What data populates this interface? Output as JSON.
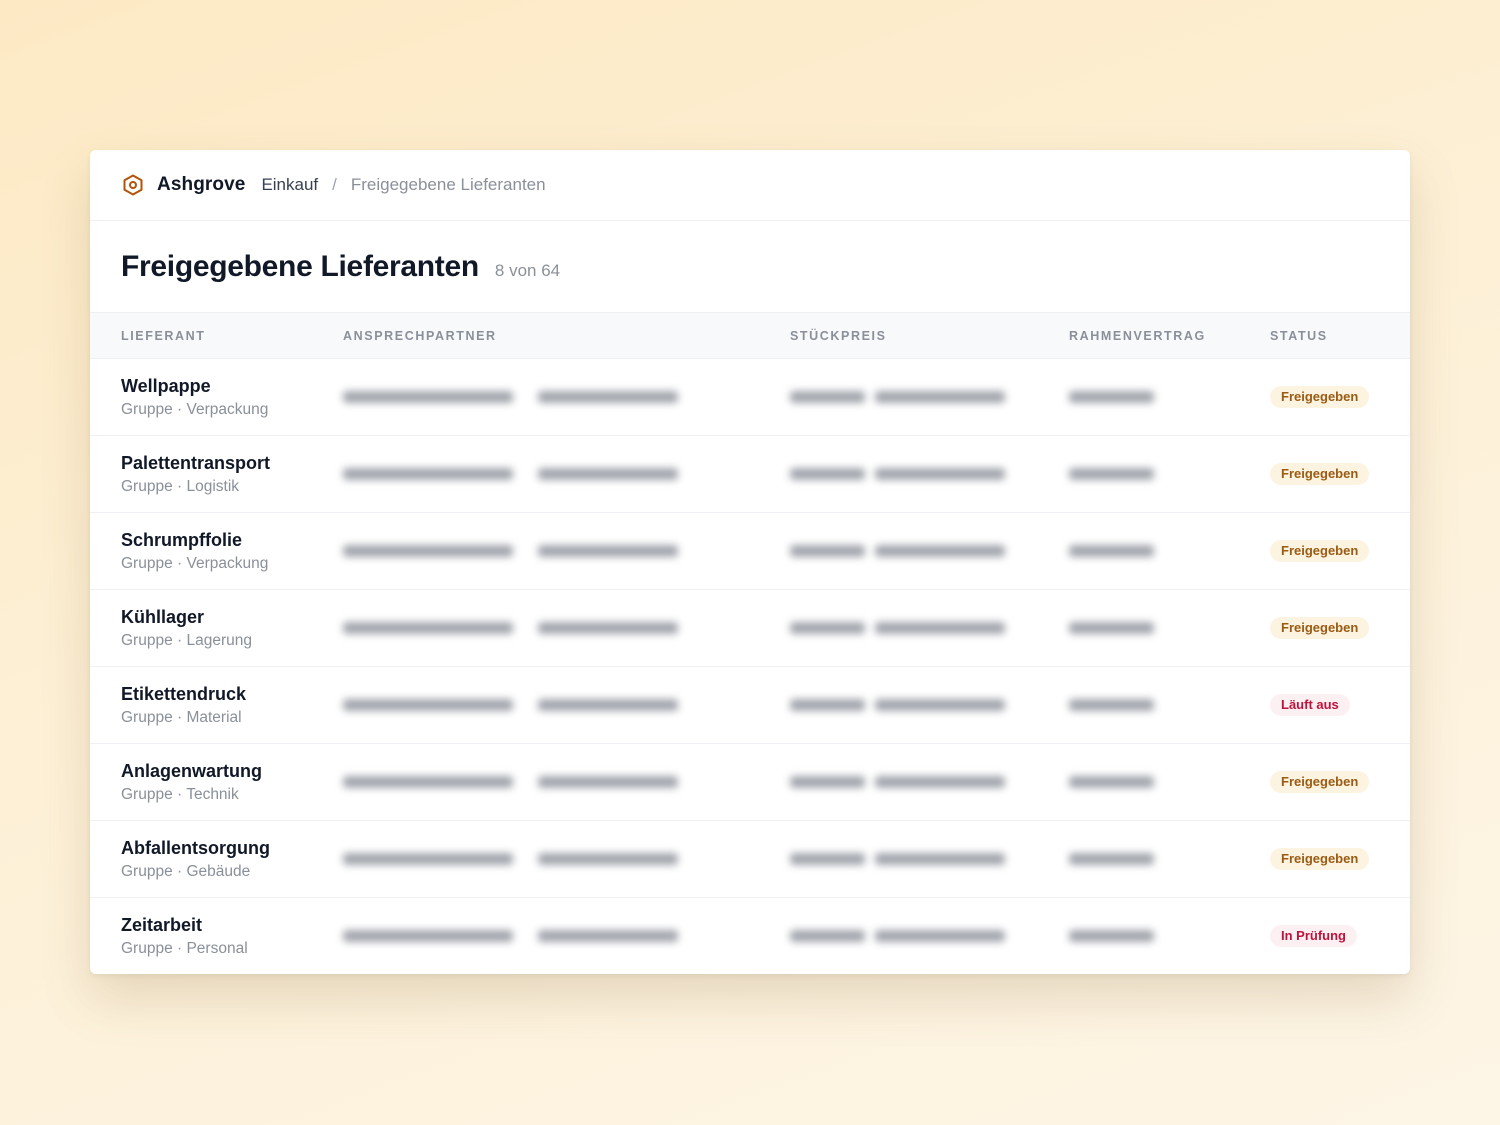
{
  "colors": {
    "accent": "#b45309",
    "badge_approved_bg": "#fdf3e1",
    "badge_approved_text": "#9a5b12",
    "badge_warning_bg": "#fdf0f2",
    "badge_warning_text": "#be123c"
  },
  "header": {
    "logo_icon": "hexagon-icon",
    "brand": "Ashgrove",
    "breadcrumb": {
      "parent": "Einkauf",
      "separator": "/",
      "current": "Freigegebene Lieferanten"
    }
  },
  "page": {
    "title": "Freigegebene Lieferanten",
    "count": "8 von 64"
  },
  "table": {
    "columns": [
      "LIEFERANT",
      "ANSPRECHPARTNER",
      "STÜCKPREIS",
      "RAHMENVERTRAG",
      "STATUS"
    ],
    "rows": [
      {
        "name": "Wellpappe",
        "group": "Gruppe · Verpackung",
        "status": "Freigegeben",
        "status_kind": "approved"
      },
      {
        "name": "Palettentransport",
        "group": "Gruppe · Logistik",
        "status": "Freigegeben",
        "status_kind": "approved"
      },
      {
        "name": "Schrumpffolie",
        "group": "Gruppe · Verpackung",
        "status": "Freigegeben",
        "status_kind": "approved"
      },
      {
        "name": "Kühllager",
        "group": "Gruppe · Lagerung",
        "status": "Freigegeben",
        "status_kind": "approved"
      },
      {
        "name": "Etikettendruck",
        "group": "Gruppe · Material",
        "status": "Läuft aus",
        "status_kind": "warning"
      },
      {
        "name": "Anlagenwartung",
        "group": "Gruppe · Technik",
        "status": "Freigegeben",
        "status_kind": "approved"
      },
      {
        "name": "Abfallentsorgung",
        "group": "Gruppe · Gebäude",
        "status": "Freigegeben",
        "status_kind": "approved"
      },
      {
        "name": "Zeitarbeit",
        "group": "Gruppe · Personal",
        "status": "In Prüfung",
        "status_kind": "warning"
      }
    ]
  }
}
